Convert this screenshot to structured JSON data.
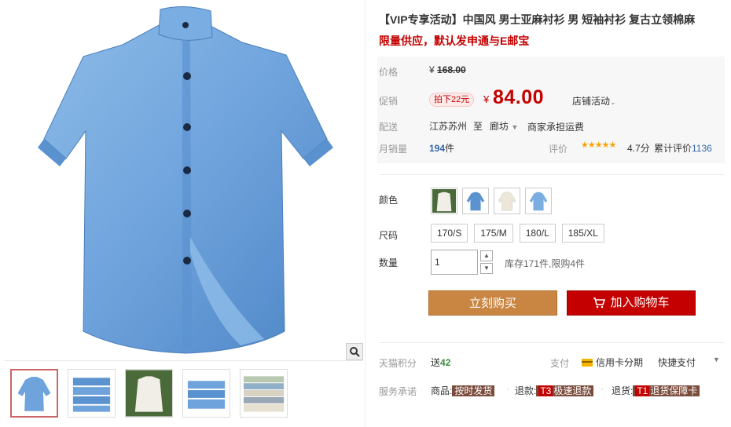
{
  "product": {
    "title": "【VIP专享活动】中国风 男士亚麻衬衫 男 短袖衬衫 复古立领棉麻",
    "subtitle": "限量供应，默认发申通与E邮宝"
  },
  "price": {
    "label": "价格",
    "currency": "¥",
    "original": "168.00"
  },
  "promo": {
    "label": "促销",
    "badge": "拍下22元",
    "currency": "¥",
    "price": "84.00",
    "shop_activity": "店铺活动"
  },
  "shipping": {
    "label": "配送",
    "from": "江苏苏州",
    "to_word": "至",
    "destination": "廊坊",
    "fee": "商家承担运费"
  },
  "sales": {
    "label": "月销量",
    "count": "194",
    "unit": "件",
    "rate_label": "评价",
    "stars": "★★★★★",
    "rating": "4.7分",
    "review_label": "累计评价",
    "review_count": "1136"
  },
  "options": {
    "color_label": "颜色",
    "size_label": "尺码",
    "sizes": [
      "170/S",
      "175/M",
      "180/L",
      "185/XL"
    ],
    "qty_label": "数量",
    "qty_value": "1",
    "stock": "库存171件,限购4件"
  },
  "actions": {
    "buy": "立刻购买",
    "cart": "加入购物车"
  },
  "points": {
    "label": "天猫积分",
    "prefix": "送",
    "value": "42"
  },
  "payment": {
    "label": "支付",
    "credit": "信用卡分期",
    "quick": "快捷支付"
  },
  "service": {
    "label": "服务承诺",
    "goods_label": "商品:",
    "goods_tag": "按时发货",
    "refund_label": "退款:",
    "refund_pre": "T3",
    "refund_tag": "极速退款",
    "return_label": "退货:",
    "return_pre": "T1",
    "return_tag": "退货保障卡"
  },
  "colors": {
    "accent": "#c40000",
    "buy_button": "#c98643",
    "shirt_blue": "#6fa3dc"
  },
  "icons": {
    "zoom": "magnifier-icon",
    "cart": "cart-icon",
    "credit": "credit-card-icon"
  }
}
